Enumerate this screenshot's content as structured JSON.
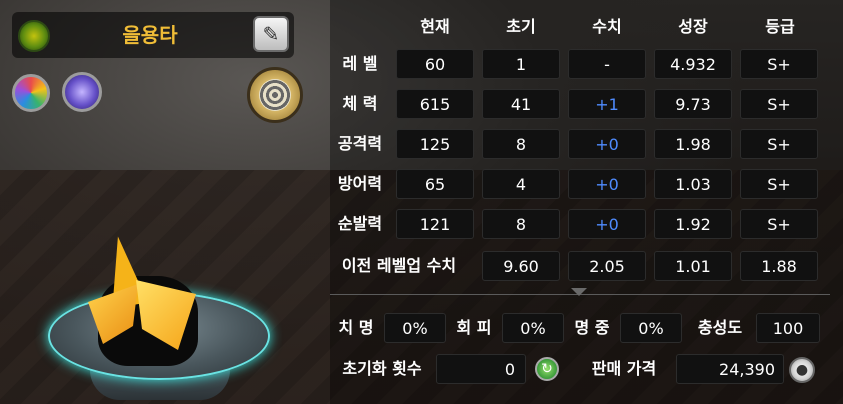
{
  "character": {
    "name": "을용타"
  },
  "headers": [
    "현재",
    "초기",
    "수치",
    "성장",
    "등급"
  ],
  "stats": [
    {
      "label": "레 벨",
      "current": "60",
      "initial": "1",
      "value": "-",
      "growth": "4.932",
      "grade": "S+"
    },
    {
      "label": "체 력",
      "current": "615",
      "initial": "41",
      "value": "+1",
      "growth": "9.73",
      "grade": "S+"
    },
    {
      "label": "공격력",
      "current": "125",
      "initial": "8",
      "value": "+0",
      "growth": "1.98",
      "grade": "S+"
    },
    {
      "label": "방어력",
      "current": "65",
      "initial": "4",
      "value": "+0",
      "growth": "1.03",
      "grade": "S+"
    },
    {
      "label": "순발력",
      "current": "121",
      "initial": "8",
      "value": "+0",
      "growth": "1.92",
      "grade": "S+"
    }
  ],
  "levelup": {
    "label": "이전 레벨업 수치",
    "values": [
      "9.60",
      "2.05",
      "1.01",
      "1.88"
    ]
  },
  "extra": {
    "crit_label": "치 명",
    "crit": "0%",
    "evade_label": "회 피",
    "evade": "0%",
    "hit_label": "명 중",
    "hit": "0%",
    "loyalty_label": "충성도",
    "loyalty": "100"
  },
  "bottom": {
    "reset_label": "초기화 횟수",
    "reset_count": "0",
    "price_label": "판매 가격",
    "price": "24,390"
  },
  "icons": {
    "leaf": "leaf-icon",
    "edit": "pencil-icon",
    "skill1": "rainbow-orb-icon",
    "skill2": "purple-orb-icon",
    "medal": "medal-icon",
    "reset": "refresh-icon",
    "coin": "coin-icon"
  },
  "colors": {
    "name": "#f0bd37",
    "positive_value": "#4f8cff"
  }
}
